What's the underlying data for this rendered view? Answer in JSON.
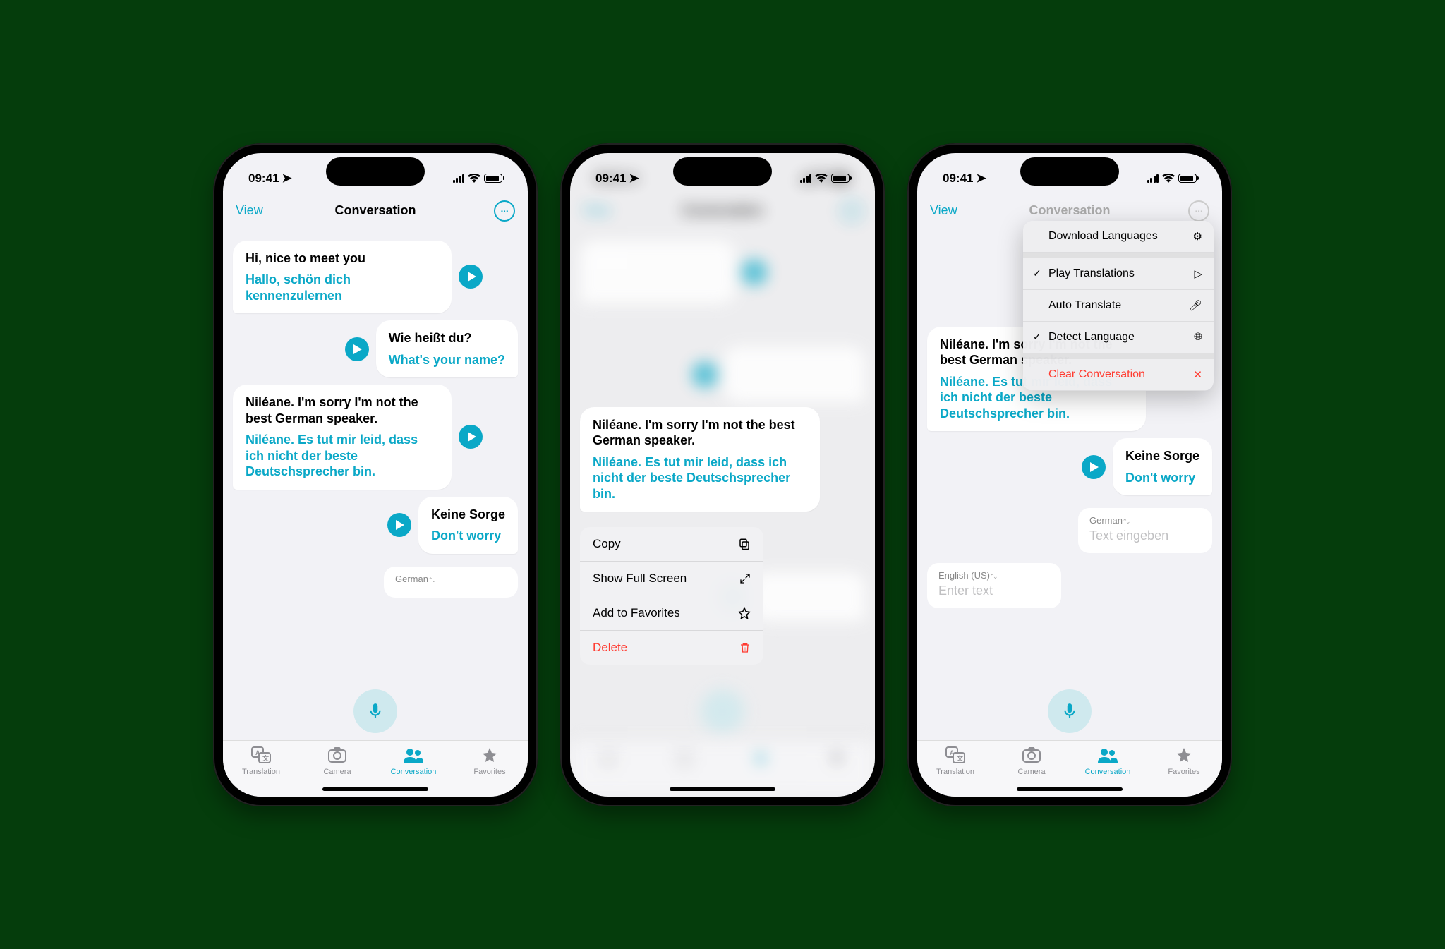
{
  "status": {
    "time": "09:41"
  },
  "nav": {
    "view": "View",
    "title": "Conversation"
  },
  "messages": [
    {
      "side": "left",
      "orig": "Hi, nice to meet you",
      "trans": "Hallo, schön dich kennenzulernen"
    },
    {
      "side": "right",
      "orig": "Wie heißt du?",
      "trans": "What's your name?"
    },
    {
      "side": "left",
      "orig": "Niléane. I'm sorry I'm not the best German speaker.",
      "trans": "Niléane. Es tut mir leid, dass ich nicht der beste Deutschsprecher bin."
    },
    {
      "side": "right",
      "orig": "Keine Sorge",
      "trans": "Don't worry"
    }
  ],
  "input_box1": {
    "lang": "German",
    "placeholder": "Text eingeben"
  },
  "input_box2": {
    "lang": "English (US)",
    "placeholder": "Enter text"
  },
  "tabs": {
    "translation": "Translation",
    "camera": "Camera",
    "conversation": "Conversation",
    "favorites": "Favorites"
  },
  "context_menu": {
    "copy": "Copy",
    "full_screen": "Show Full Screen",
    "add_fav": "Add to Favorites",
    "delete": "Delete"
  },
  "dropdown": {
    "download": "Download Languages",
    "play_trans": "Play Translations",
    "auto_trans": "Auto Translate",
    "detect": "Detect Language",
    "clear": "Clear Conversation"
  }
}
